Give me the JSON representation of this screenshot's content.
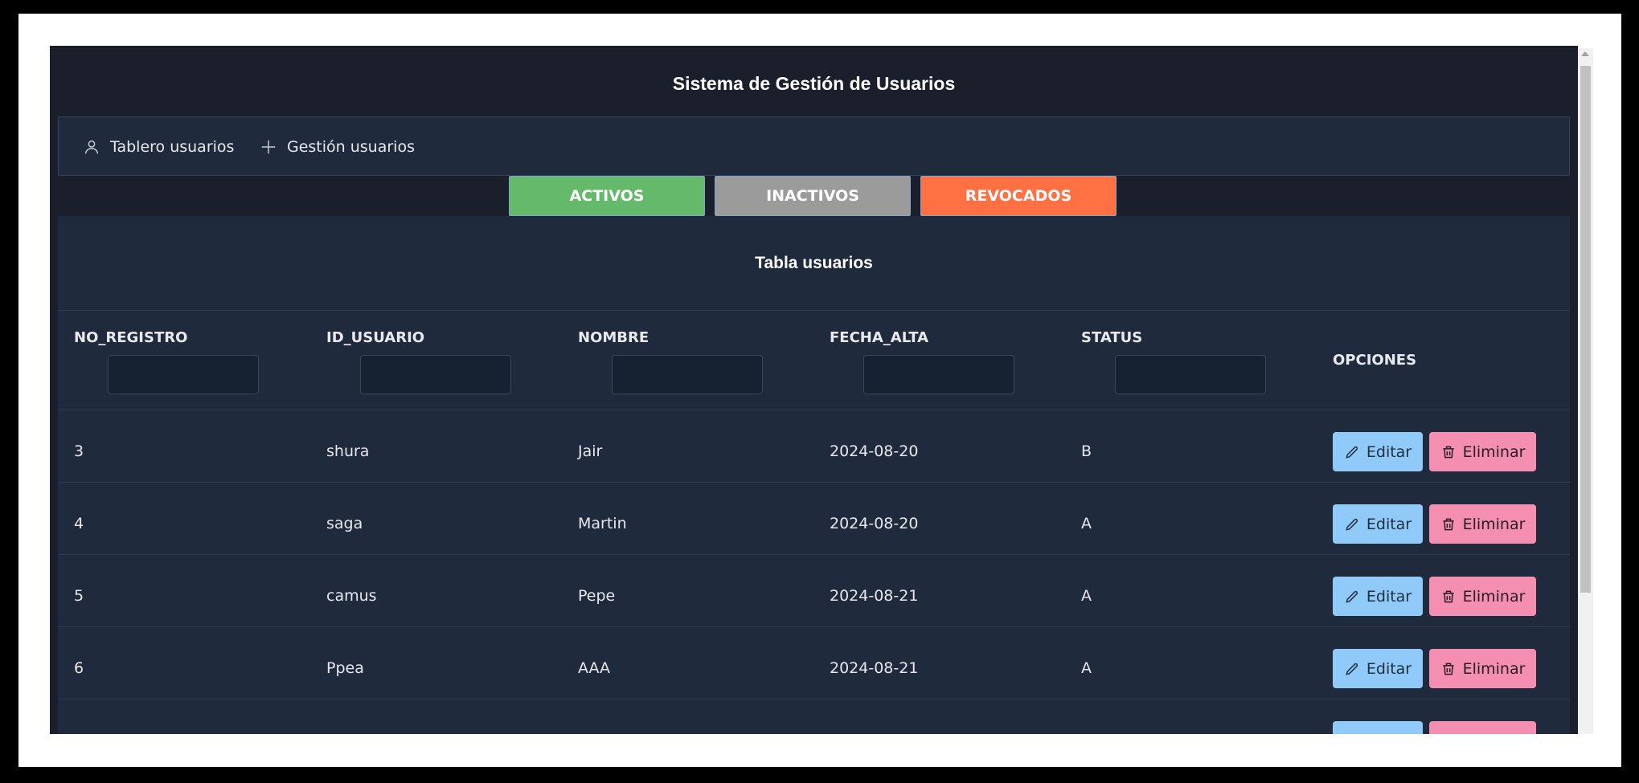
{
  "app": {
    "title": "Sistema de Gestión de Usuarios"
  },
  "nav": [
    {
      "label": "Tablero usuarios",
      "icon": "user-icon"
    },
    {
      "label": "Gestión usuarios",
      "icon": "plus-icon"
    }
  ],
  "filters": [
    {
      "label": "ACTIVOS",
      "color": "#64b96a"
    },
    {
      "label": "INACTIVOS",
      "color": "#9b9b9b"
    },
    {
      "label": "REVOCADOS",
      "color": "#ff7043"
    }
  ],
  "table": {
    "title": "Tabla usuarios",
    "columns": [
      "NO_REGISTRO",
      "ID_USUARIO",
      "NOMBRE",
      "FECHA_ALTA",
      "STATUS",
      "OPCIONES"
    ],
    "rows": [
      {
        "no_registro": "3",
        "id_usuario": "shura",
        "nombre": "Jair",
        "fecha_alta": "2024-08-20",
        "status": "B"
      },
      {
        "no_registro": "4",
        "id_usuario": "saga",
        "nombre": "Martin",
        "fecha_alta": "2024-08-20",
        "status": "A"
      },
      {
        "no_registro": "5",
        "id_usuario": "camus",
        "nombre": "Pepe",
        "fecha_alta": "2024-08-21",
        "status": "A"
      },
      {
        "no_registro": "6",
        "id_usuario": "Ppea",
        "nombre": "AAA",
        "fecha_alta": "2024-08-21",
        "status": "A"
      }
    ],
    "actions": {
      "edit_label": "Editar",
      "delete_label": "Eliminar"
    }
  },
  "colors": {
    "background": "#1b1e2b",
    "panel": "#1f2a3d",
    "edit": "#90caf9",
    "delete": "#f48fb1"
  }
}
